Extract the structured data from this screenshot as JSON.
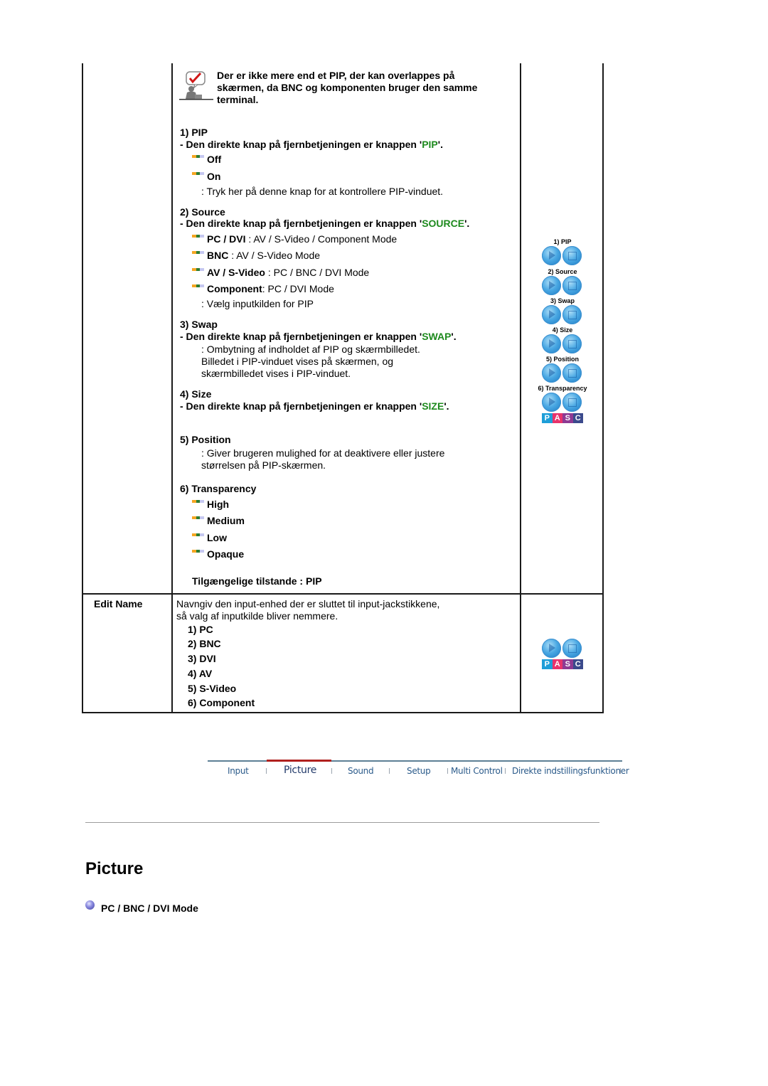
{
  "note": {
    "text": "Der er ikke mere end et PIP, der kan overlappes på skærmen, da BNC og komponenten bruger den samme terminal."
  },
  "pip_section": {
    "sections": {
      "pip": {
        "title": "1) PIP",
        "direct_prefix": "- Den direkte knap på fjernbetjeningen er knappen '",
        "direct_key": "PIP",
        "direct_suffix": "'.",
        "options": [
          "Off",
          "On"
        ],
        "description": ": Tryk her på denne knap for at kontrollere PIP-vinduet."
      },
      "source": {
        "title": "2) Source",
        "direct_prefix": "- Den direkte knap på fjernbetjeningen er knappen '",
        "direct_key": "SOURCE",
        "direct_suffix": "'.",
        "options": [
          {
            "label": "PC / DVI",
            "detail": " : AV / S-Video / Component Mode"
          },
          {
            "label": "BNC",
            "detail": " : AV / S-Video Mode"
          },
          {
            "label": "AV / S-Video",
            "detail": " : PC / BNC / DVI Mode"
          },
          {
            "label": "Component",
            "detail": ": PC / DVI Mode"
          }
        ],
        "description": ": Vælg inputkilden for PIP"
      },
      "swap": {
        "title": "3) Swap",
        "direct_prefix": "- Den direkte knap på fjernbetjeningen er knappen '",
        "direct_key": "SWAP",
        "direct_suffix": "'.",
        "description_lines": [
          ": Ombytning af indholdet af PIP og skærmbilledet.",
          "Billedet i PIP-vinduet vises på skærmen, og",
          "skærmbilledet vises i PIP-vinduet."
        ]
      },
      "size": {
        "title": "4) Size",
        "direct_prefix": "- Den direkte knap på fjernbetjeningen er knappen '",
        "direct_key": "SIZE",
        "direct_suffix": "'."
      },
      "position": {
        "title": "5) Position",
        "description_lines": [
          ": Giver brugeren mulighed for at deaktivere eller justere",
          "størrelsen på PIP-skærmen."
        ]
      },
      "transparency": {
        "title": "6) Transparency",
        "options": [
          "High",
          "Medium",
          "Low",
          "Opaque"
        ]
      }
    },
    "available_modes": "Tilgængelige tilstande : PIP",
    "side_buttons": [
      "1) PIP",
      "2) Source",
      "3) Swap",
      "4) Size",
      "5) Position",
      "6) Transparency"
    ]
  },
  "edit_name": {
    "label": "Edit Name",
    "description_lines": [
      "Navngiv den input-enhed der er sluttet til input-jackstikkene,",
      "så valg af inputkilde bliver nemmere."
    ],
    "items": [
      "1) PC",
      "2) BNC",
      "3) DVI",
      "4) AV",
      "5) S-Video",
      "6) Component"
    ]
  },
  "pasc": {
    "letters": [
      "P",
      "A",
      "S",
      "C"
    ],
    "colors": [
      "#1e9ed8",
      "#e8336b",
      "#8e3a93",
      "#3b4a8c"
    ]
  },
  "nav": {
    "items": [
      "Input",
      "Picture",
      "Sound",
      "Setup",
      "Multi Control",
      "Direkte indstillingsfunktioner"
    ],
    "active": "Picture",
    "active_color": "#b0201e"
  },
  "page": {
    "title": "Picture",
    "mode_label": "PC / BNC / DVI Mode"
  },
  "colors": {
    "key_highlight": "#1e8a1e"
  }
}
